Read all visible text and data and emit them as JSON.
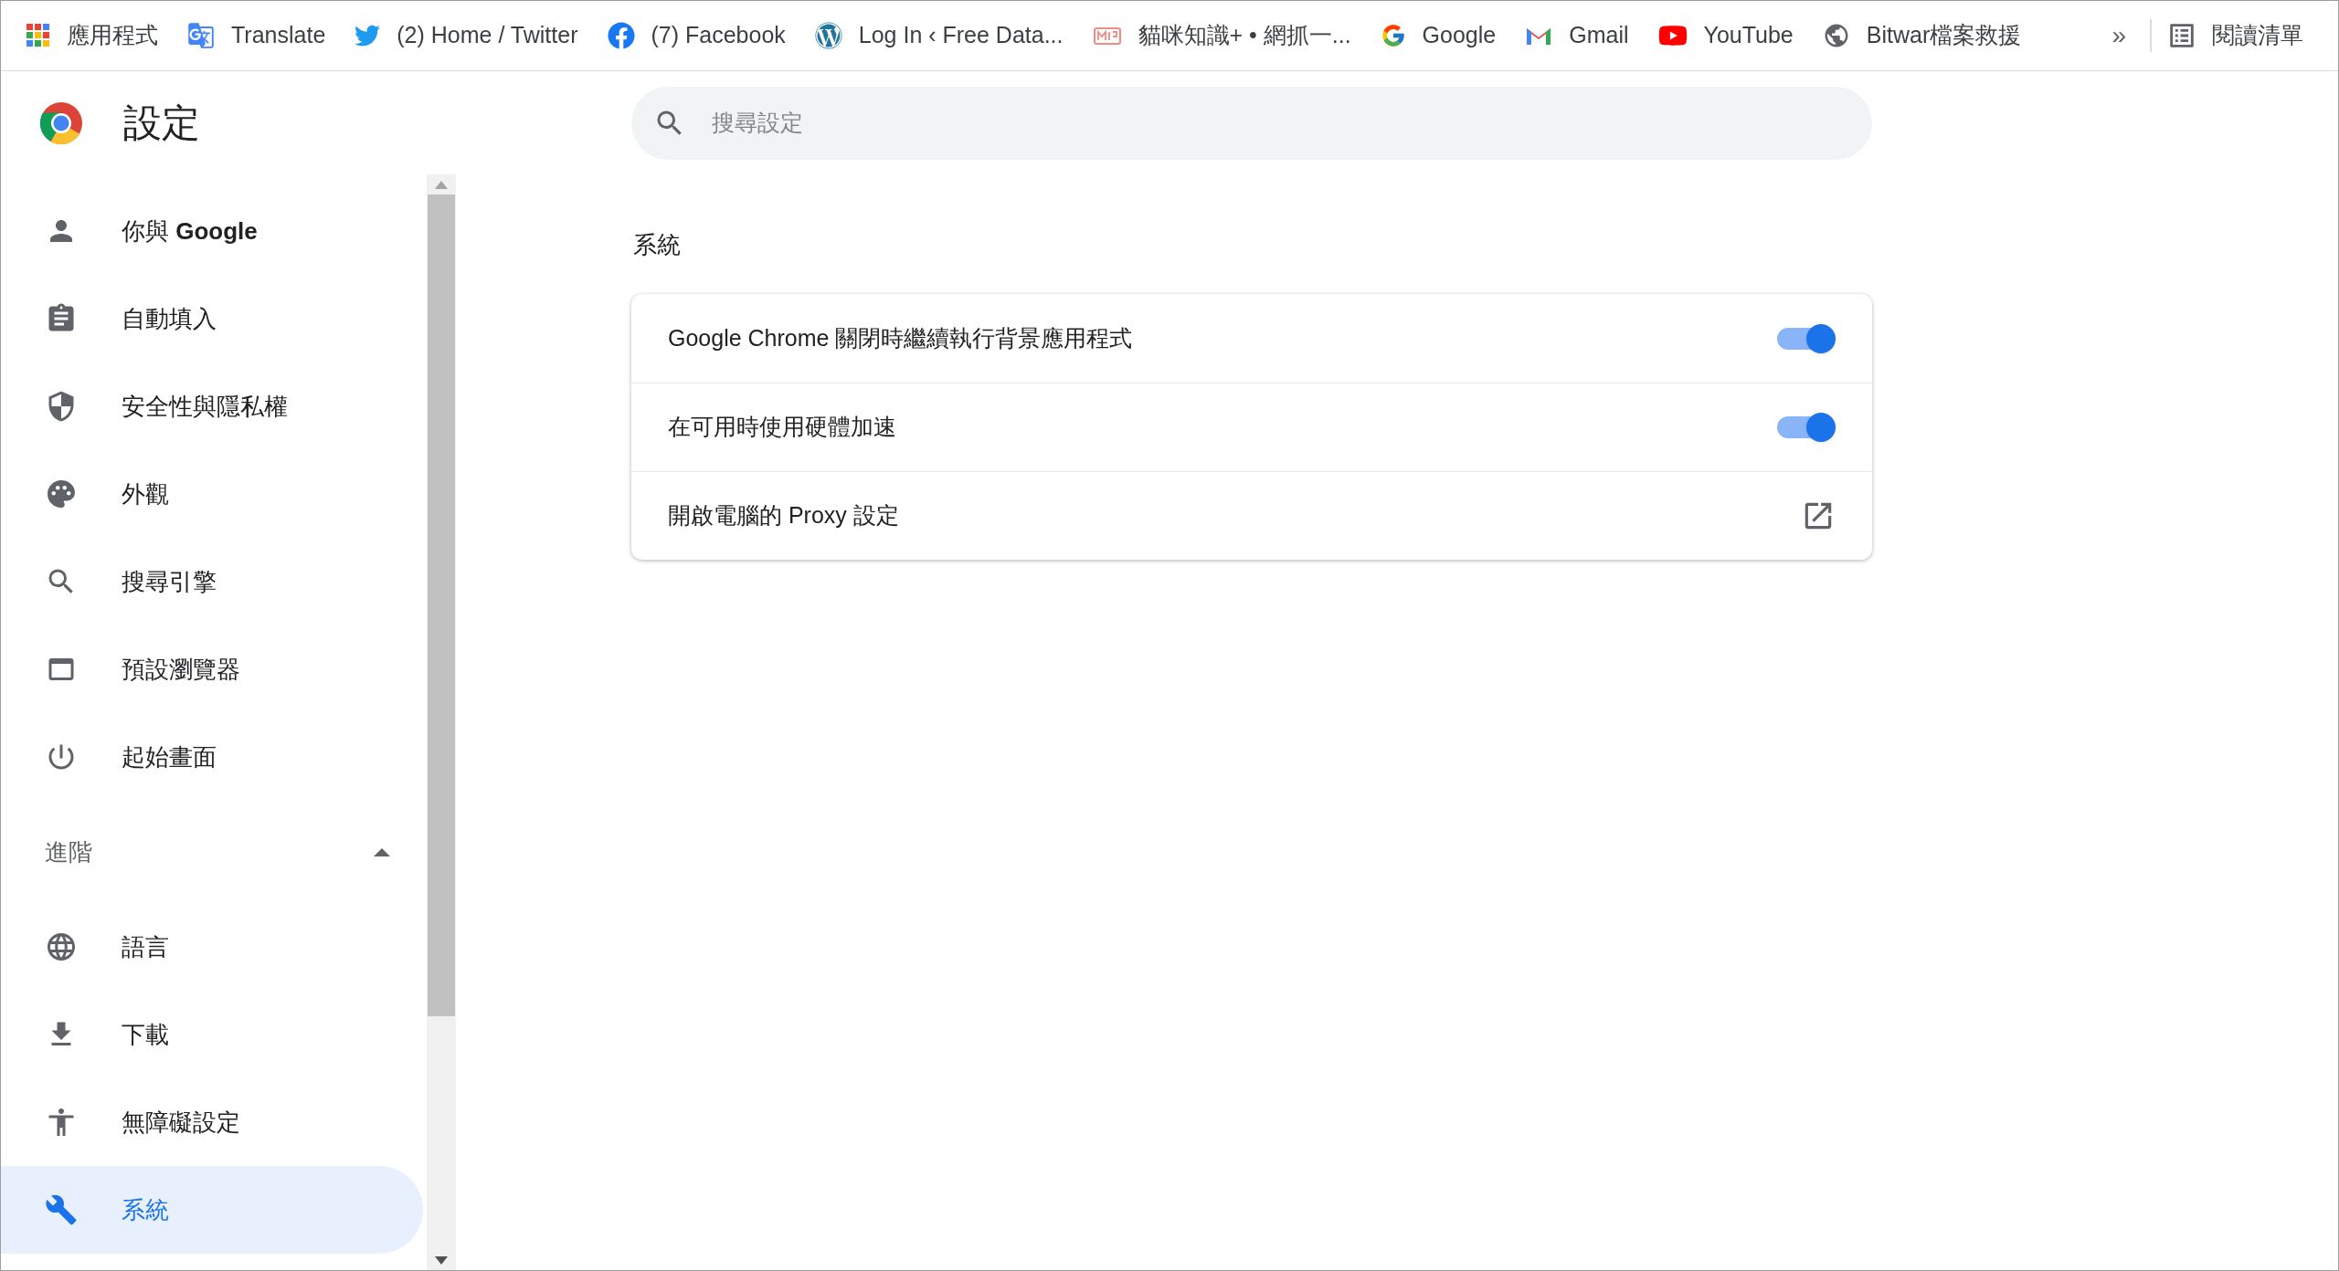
{
  "bookmarks": [
    {
      "kind": "apps",
      "label": "應用程式"
    },
    {
      "kind": "translate",
      "label": "Translate"
    },
    {
      "kind": "twitter",
      "label": "(2) Home / Twitter"
    },
    {
      "kind": "facebook",
      "label": "(7) Facebook"
    },
    {
      "kind": "wordpress",
      "label": "Log In ‹ Free Data..."
    },
    {
      "kind": "mop",
      "label": "貓咪知識+ • 網抓一..."
    },
    {
      "kind": "google",
      "label": "Google"
    },
    {
      "kind": "gmail",
      "label": "Gmail"
    },
    {
      "kind": "youtube",
      "label": "YouTube"
    },
    {
      "kind": "globe",
      "label": "Bitwar檔案救援"
    }
  ],
  "bookmarks_overflow": "»",
  "reading_list": "閱讀清單",
  "header": {
    "title": "設定"
  },
  "search": {
    "placeholder": "搜尋設定"
  },
  "sidebar": {
    "items": [
      {
        "kind": "person",
        "label": "你與 **Google**",
        "selected": false
      },
      {
        "kind": "autofill",
        "label": "自動填入",
        "selected": false
      },
      {
        "kind": "shield",
        "label": "安全性與隱私權",
        "selected": false
      },
      {
        "kind": "palette",
        "label": "外觀",
        "selected": false
      },
      {
        "kind": "search",
        "label": "搜尋引擎",
        "selected": false
      },
      {
        "kind": "browser",
        "label": "預設瀏覽器",
        "selected": false
      },
      {
        "kind": "power",
        "label": "起始畫面",
        "selected": false
      }
    ],
    "advanced": {
      "label": "進階",
      "expanded": true,
      "items": [
        {
          "kind": "globe",
          "label": "語言",
          "selected": false
        },
        {
          "kind": "download",
          "label": "下載",
          "selected": false
        },
        {
          "kind": "accessibility",
          "label": "無障礙設定",
          "selected": false
        },
        {
          "kind": "wrench",
          "label": "系統",
          "selected": true
        }
      ]
    }
  },
  "section": {
    "title": "系統",
    "rows": [
      {
        "kind": "toggle",
        "label": "Google Chrome 關閉時繼續執行背景應用程式",
        "on": true
      },
      {
        "kind": "toggle",
        "label": "在可用時使用硬體加速",
        "on": true
      },
      {
        "kind": "link",
        "label": "開啟電腦的 Proxy 設定"
      }
    ]
  }
}
